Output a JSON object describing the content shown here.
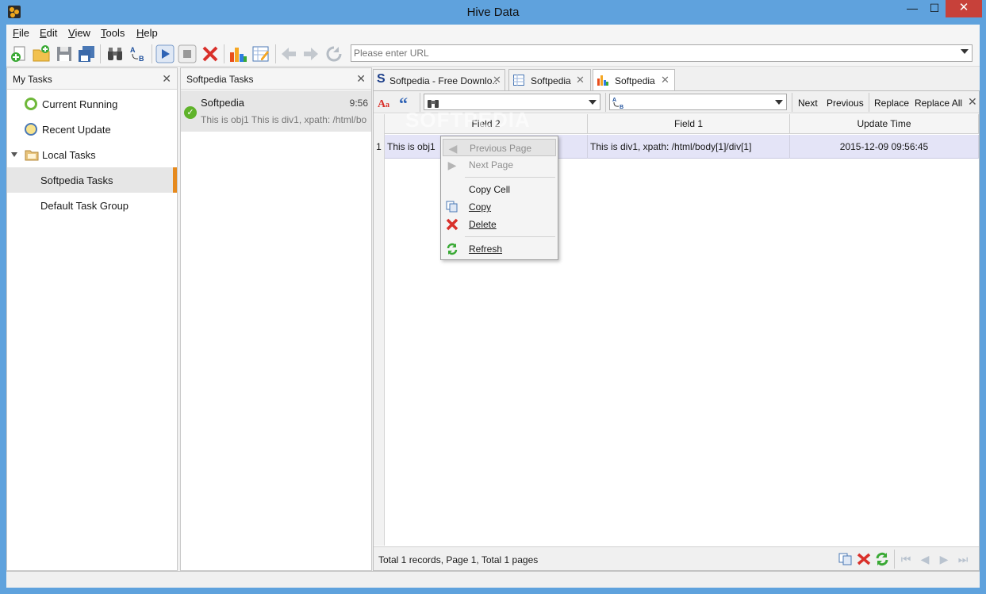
{
  "window": {
    "title": "Hive Data",
    "minimize": "—",
    "maximize": "☐",
    "close": "✕"
  },
  "menu": [
    {
      "key": "F",
      "rest": "ile"
    },
    {
      "key": "E",
      "rest": "dit"
    },
    {
      "key": "V",
      "rest": "iew"
    },
    {
      "key": "T",
      "rest": "ools"
    },
    {
      "key": "H",
      "rest": "elp"
    }
  ],
  "toolbar": {
    "url_placeholder": "Please enter URL",
    "icons": [
      "new-task-icon",
      "new-folder-icon",
      "save-icon",
      "save-all-icon",
      "find-icon",
      "extract-icon",
      "run-icon",
      "stop-icon",
      "cancel-icon",
      "chart-icon",
      "edit-table-icon",
      "back-icon",
      "forward-icon",
      "reload-icon"
    ]
  },
  "my_tasks": {
    "title": "My Tasks",
    "close": "✕",
    "items": [
      {
        "label": "Current Running",
        "icon": "running-icon"
      },
      {
        "label": "Recent Update",
        "icon": "clock-icon"
      },
      {
        "label": "Local Tasks",
        "icon": "folder-icon"
      },
      {
        "label": "Softpedia Tasks"
      },
      {
        "label": "Default Task Group"
      }
    ]
  },
  "softpedia_tasks": {
    "title": "Softpedia Tasks",
    "close": "✕",
    "entry": {
      "name": "Softpedia",
      "time": "9:56",
      "preview": "This is obj1 This is div1, xpath: /html/bo"
    }
  },
  "tabs": [
    {
      "label": "Softpedia - Free Downlo..",
      "icon": "softpedia-s-icon",
      "close": "✕"
    },
    {
      "label": "Softpedia",
      "icon": "table-icon",
      "close": "✕"
    },
    {
      "label": "Softpedia",
      "icon": "chart-icon",
      "close": "✕",
      "active": true
    }
  ],
  "findbar": {
    "next": "Next",
    "previous": "Previous",
    "replace": "Replace",
    "replace_all": "Replace All",
    "close": "✕"
  },
  "grid": {
    "columns": [
      "Field 2",
      "Field 1",
      "Update Time"
    ],
    "rows": [
      {
        "num": "1",
        "field2": "This is obj1",
        "field1": "This is div1, xpath: /html/body[1]/div[1]",
        "update_time": "2015-12-09 09:56:45"
      }
    ]
  },
  "status": {
    "text": "Total 1 records, Page 1, Total 1 pages"
  },
  "context_menu": {
    "items": [
      {
        "label": "Previous Page",
        "state": "disabled-hover"
      },
      {
        "label": "Next Page",
        "state": "disabled"
      },
      {
        "label": "Copy Cell"
      },
      {
        "label": "Copy"
      },
      {
        "label": "Delete"
      },
      {
        "label": "Refresh"
      }
    ]
  },
  "watermark": "SOFTPEDIA"
}
